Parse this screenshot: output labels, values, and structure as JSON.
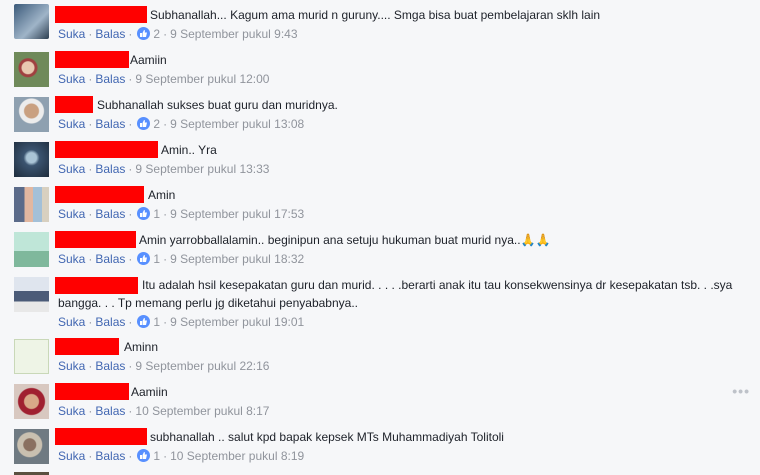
{
  "actions": {
    "like": "Suka",
    "reply": "Balas",
    "sep": "·"
  },
  "comments": [
    {
      "text": "Subhanallah... Kagum ama murid n guruny.... Smga bisa buat pembelajaran sklh lain",
      "reactions": "2",
      "time": "9 September pukul 9:43"
    },
    {
      "text": "Aamiin",
      "reactions": "",
      "time": "9 September pukul 12:00"
    },
    {
      "text": "Subhanallah sukses buat guru dan muridnya.",
      "reactions": "2",
      "time": "9 September pukul 13:08"
    },
    {
      "text": "Amin.. Yra",
      "reactions": "",
      "time": "9 September pukul 13:33"
    },
    {
      "text": "Amin",
      "reactions": "1",
      "time": "9 September pukul 17:53"
    },
    {
      "text": "Amin yarrobballalamin.. beginipun ana setuju hukuman buat murid nya..🙏🙏",
      "reactions": "1",
      "time": "9 September pukul 18:32"
    },
    {
      "text": "Itu adalah hsil kesepakatan guru dan murid. . . . .berarti anak itu tau konsekwensinya dr kesepakatan tsb. . .sya bangga. . . Tp memang perlu jg diketahui penyababnya..",
      "reactions": "1",
      "time": "9 September pukul 19:01"
    },
    {
      "text": "Aminn",
      "reactions": "",
      "time": "9 September pukul 22:16"
    },
    {
      "text": "Aamiin",
      "reactions": "",
      "time": "10 September pukul 8:17"
    },
    {
      "text": "subhanallah .. salut kpd bapak kepsek MTs Muhammadiyah Tolitoli",
      "reactions": "1",
      "time": "10 September pukul 8:19"
    }
  ],
  "more_options": "•••",
  "colors": {
    "link": "#4267b2",
    "meta": "#90949c",
    "reaction": "#5890ff",
    "redaction": "#ff0000"
  }
}
